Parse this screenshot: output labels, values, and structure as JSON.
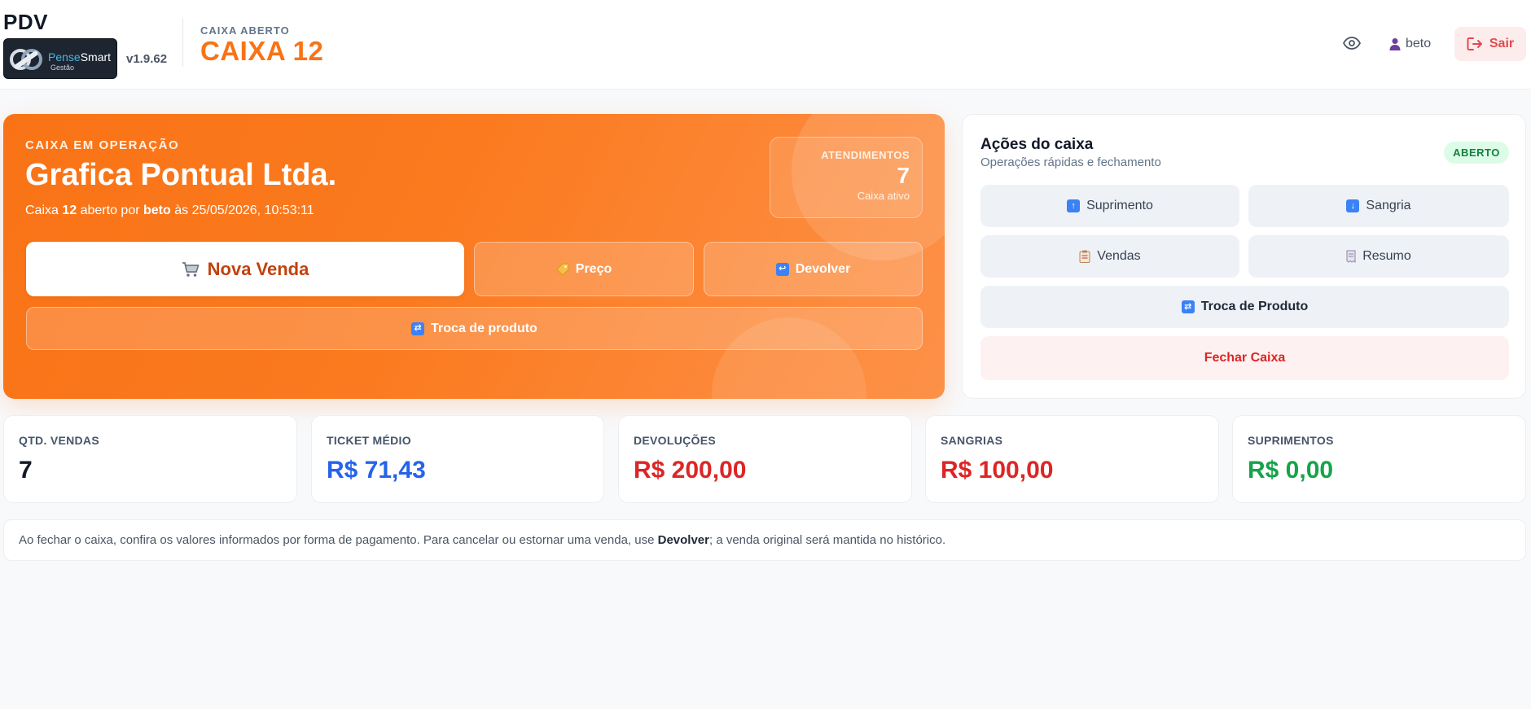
{
  "header": {
    "title": "PDV",
    "logo": {
      "name_part1": "Pense",
      "name_part2": "Smart",
      "sub": "Gestão"
    },
    "version": "v1.9.62",
    "caixa_status": "CAIXA ABERTO",
    "caixa_title": "CAIXA 12",
    "user": "beto",
    "logout_label": "Sair"
  },
  "hero": {
    "label": "CAIXA EM OPERAÇÃO",
    "company": "Grafica Pontual Ltda.",
    "info": {
      "prefix": "Caixa",
      "caixa_number": "12",
      "mid": "aberto por",
      "user": "beto",
      "suffix": "às 25/05/2026, 10:53:11"
    },
    "atendimentos": {
      "label": "ATENDIMENTOS",
      "count": "7",
      "sub": "Caixa ativo"
    },
    "buttons": {
      "nova_venda": "Nova Venda",
      "preco": "Preço",
      "devolver": "Devolver",
      "troca": "Troca de produto"
    }
  },
  "actions": {
    "title": "Ações do caixa",
    "subtitle": "Operações rápidas e fechamento",
    "status_badge": "ABERTO",
    "buttons": {
      "suprimento": "Suprimento",
      "sangria": "Sangria",
      "vendas": "Vendas",
      "resumo": "Resumo",
      "troca": "Troca de Produto",
      "fechar": "Fechar Caixa"
    }
  },
  "stats": [
    {
      "label": "QTD. VENDAS",
      "value": "7",
      "color": "#111827"
    },
    {
      "label": "TICKET MÉDIO",
      "value": "R$ 71,43",
      "color": "#2563eb"
    },
    {
      "label": "DEVOLUÇÕES",
      "value": "R$ 200,00",
      "color": "#dc2626"
    },
    {
      "label": "SANGRIAS",
      "value": "R$ 100,00",
      "color": "#dc2626"
    },
    {
      "label": "SUPRIMENTOS",
      "value": "R$ 0,00",
      "color": "#16a34a"
    }
  ],
  "footer_note": {
    "before": "Ao fechar o caixa, confira os valores informados por forma de pagamento. Para cancelar ou estornar uma venda, use",
    "bold": "Devolver",
    "after": "; a venda original será mantida no histórico."
  },
  "colors": {
    "accent": "#f97316",
    "danger": "#dc2626",
    "success": "#16a34a",
    "info": "#2563eb"
  }
}
